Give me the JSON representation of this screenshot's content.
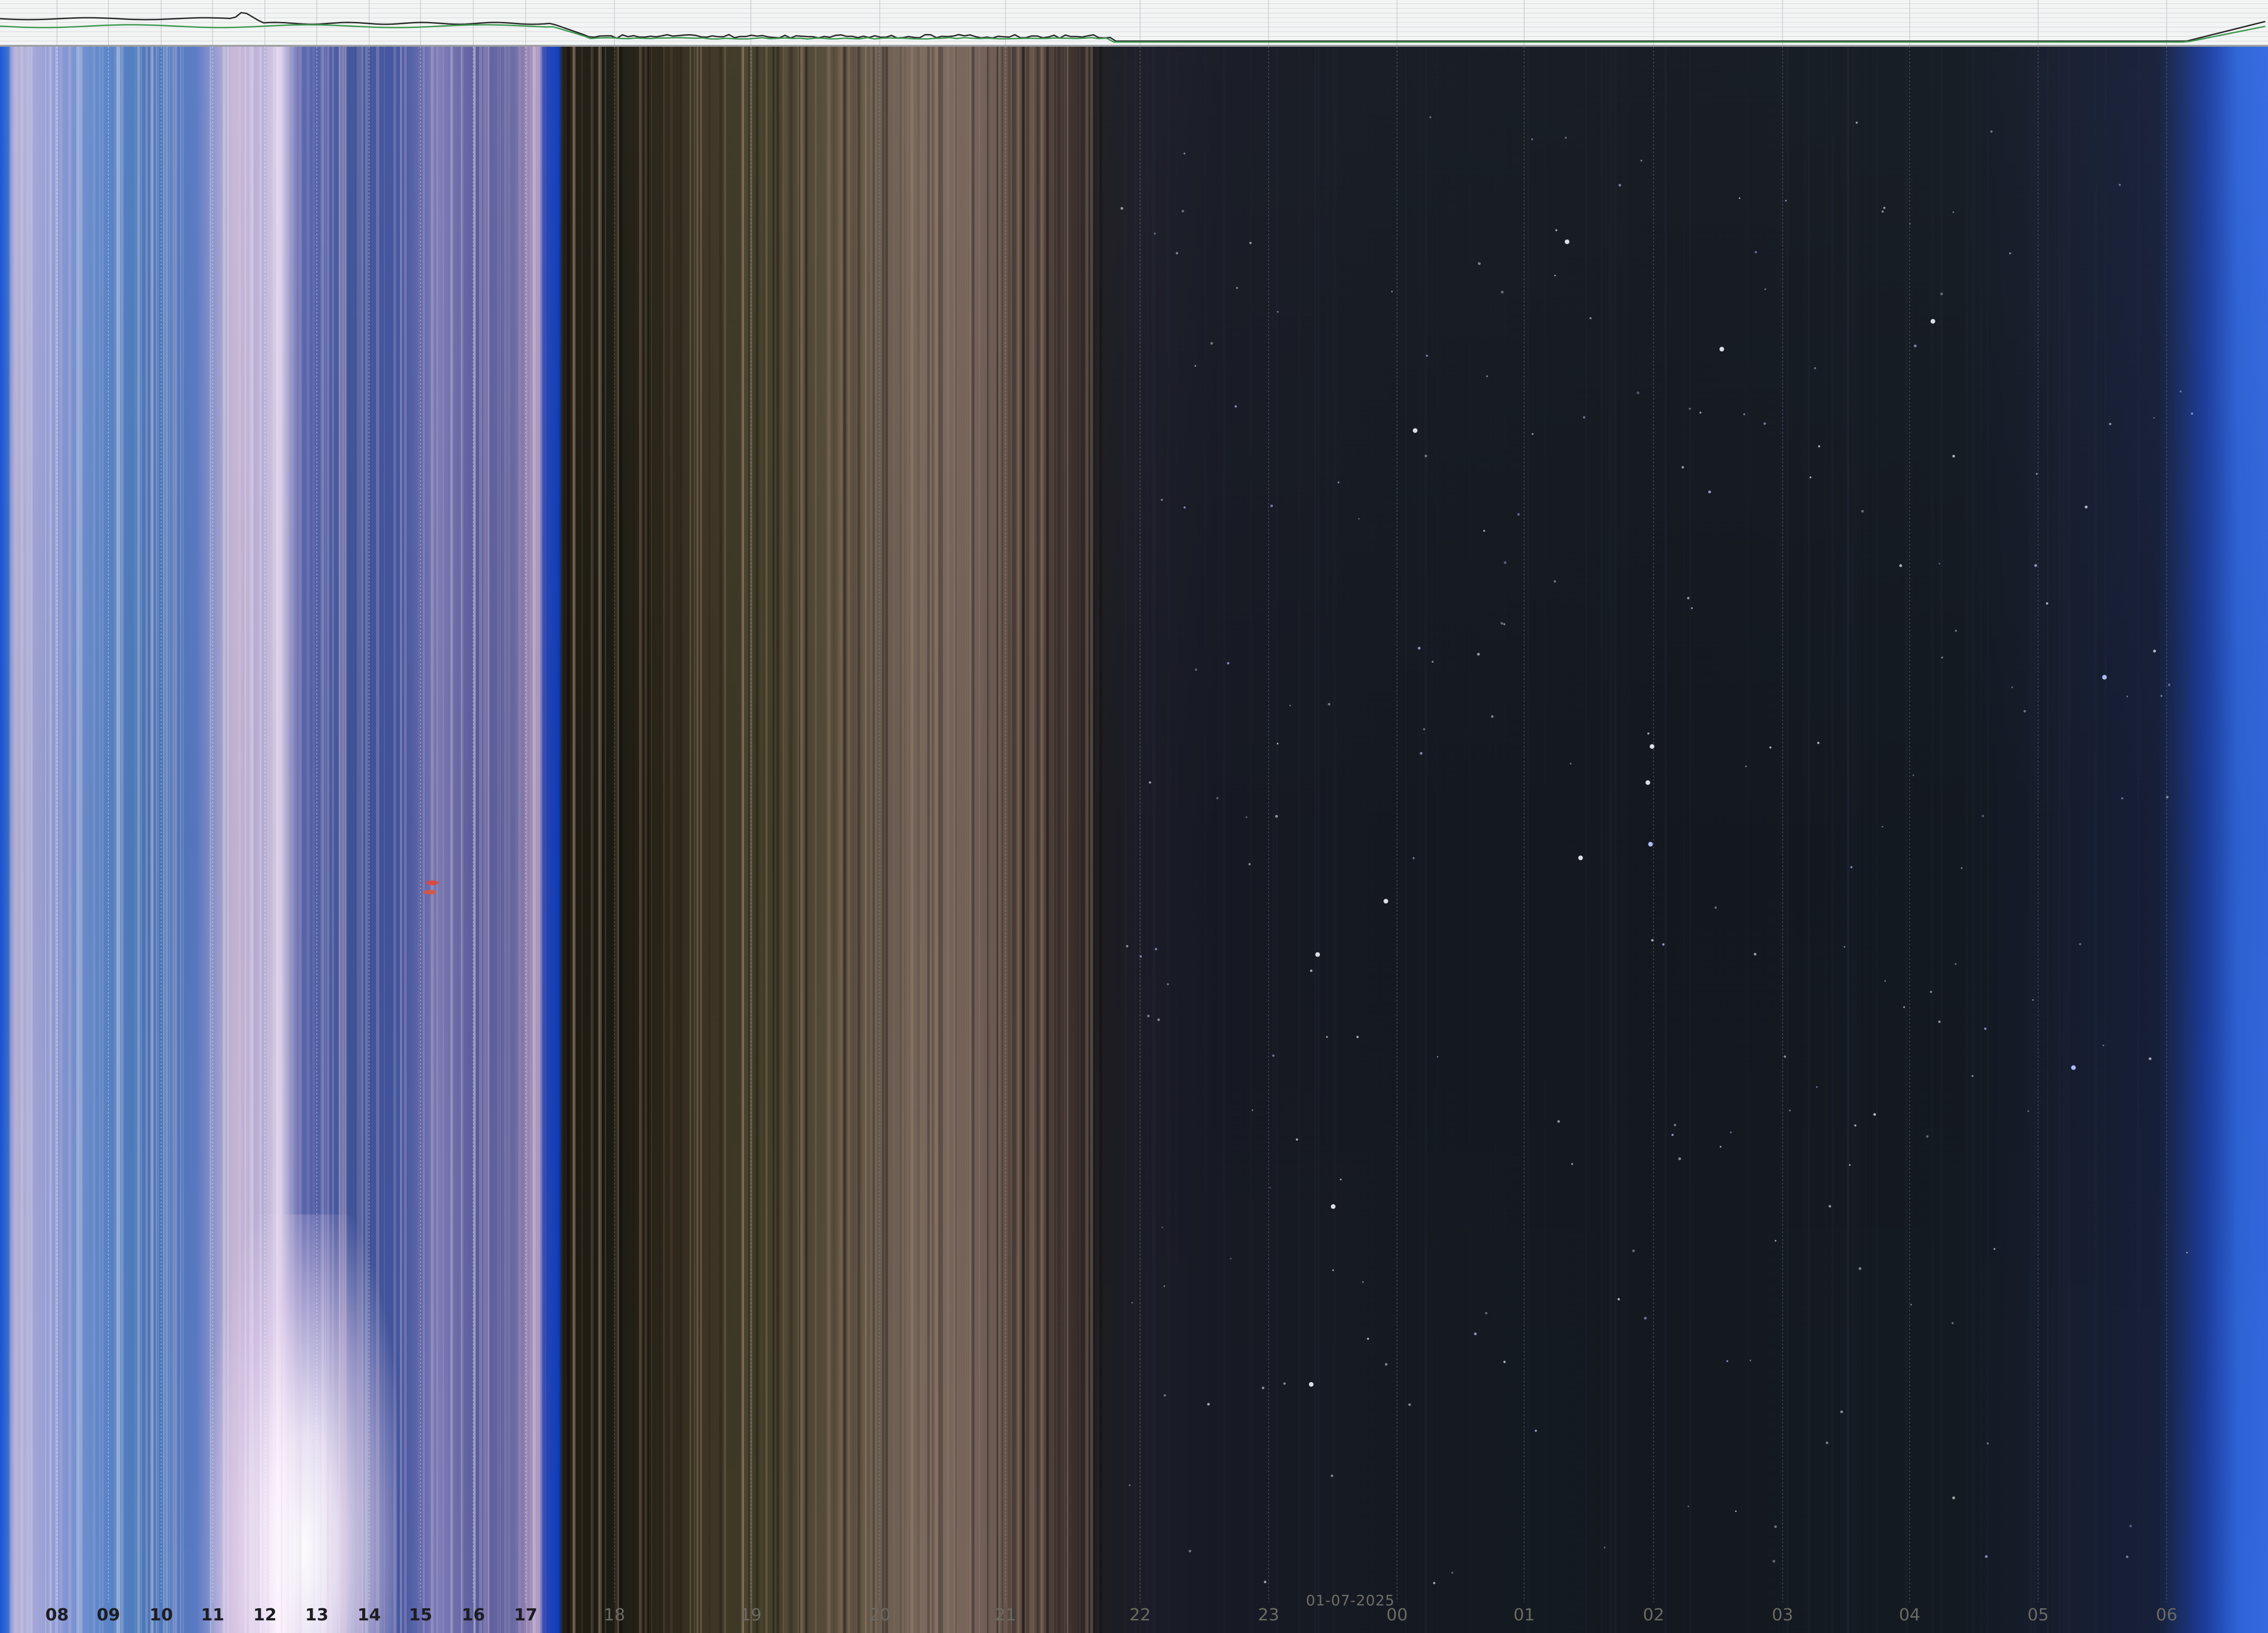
{
  "date_label": "01-07-2025",
  "hour_labels": [
    "08",
    "09",
    "10",
    "11",
    "12",
    "13",
    "14",
    "15",
    "16",
    "17",
    "18",
    "19",
    "20",
    "21",
    "22",
    "23",
    "00",
    "01",
    "02",
    "03",
    "04",
    "05",
    "06"
  ],
  "colors": {
    "day_label": "#1d1d22",
    "night_label": "#6b6a62",
    "graph_background": "#f3f4f4",
    "graph_line_dark": "#2b2b2b",
    "graph_line_green": "#3f9a52",
    "sun_glare": "#ffffff",
    "twilight_blue": "#0e3fbe"
  }
}
